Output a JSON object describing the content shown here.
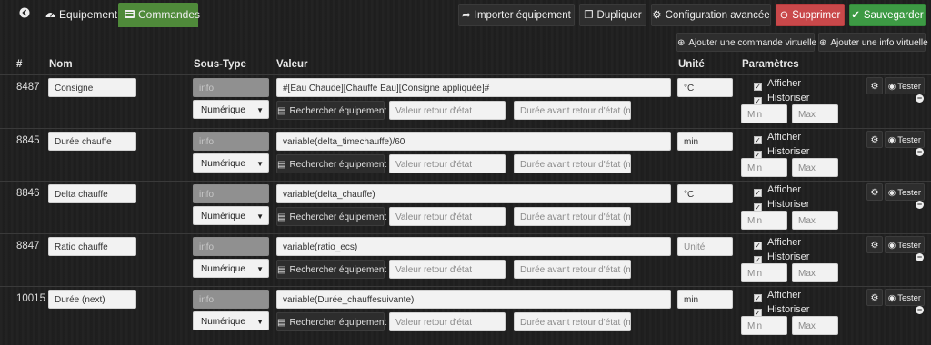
{
  "tabs": {
    "back_icon": "arrow-circle-left-icon",
    "equipement": "Equipement",
    "commandes": "Commandes"
  },
  "toolbar": {
    "importer": "Importer équipement",
    "dupliquer": "Dupliquer",
    "config": "Configuration avancée",
    "supprimer": "Supprimer",
    "sauvegarder": "Sauvegarder",
    "add_cmd": "Ajouter une commande virtuelle",
    "add_info": "Ajouter une info virtuelle"
  },
  "columns": {
    "id": "#",
    "nom": "Nom",
    "sous_type": "Sous-Type",
    "valeur": "Valeur",
    "unite": "Unité",
    "parametres": "Paramètres"
  },
  "labels": {
    "info": "info",
    "rechercher": "Rechercher équipement",
    "valeur_retour": "Valeur retour d'état",
    "duree_retour": "Durée avant retour d'état (mi",
    "afficher": "Afficher",
    "historiser": "Historiser",
    "min": "Min",
    "max": "Max",
    "tester": "Tester",
    "unite_placeholder": "Unité"
  },
  "rows": [
    {
      "id": "8487",
      "nom": "Consigne",
      "sous_type": "Numérique",
      "valeur": "#[Eau Chaude][Chauffe Eau][Consigne appliquée]#",
      "unite": "°C"
    },
    {
      "id": "8845",
      "nom": "Durée chauffe",
      "sous_type": "Numérique",
      "valeur": "variable(delta_timechauffe)/60",
      "unite": "min"
    },
    {
      "id": "8846",
      "nom": "Delta chauffe",
      "sous_type": "Numérique",
      "valeur": "variable(delta_chauffe)",
      "unite": "°C"
    },
    {
      "id": "8847",
      "nom": "Ratio chauffe",
      "sous_type": "Numérique",
      "valeur": "variable(ratio_ecs)",
      "unite": ""
    },
    {
      "id": "10015",
      "nom": "Durée (next)",
      "sous_type": "Numérique",
      "valeur": "variable(Durée_chauffesuivante)",
      "unite": "min"
    }
  ],
  "colors": {
    "tab_active": "#4f8a3a",
    "danger": "#c9484a",
    "success": "#3d9a44",
    "background": "#1f1f1f"
  }
}
